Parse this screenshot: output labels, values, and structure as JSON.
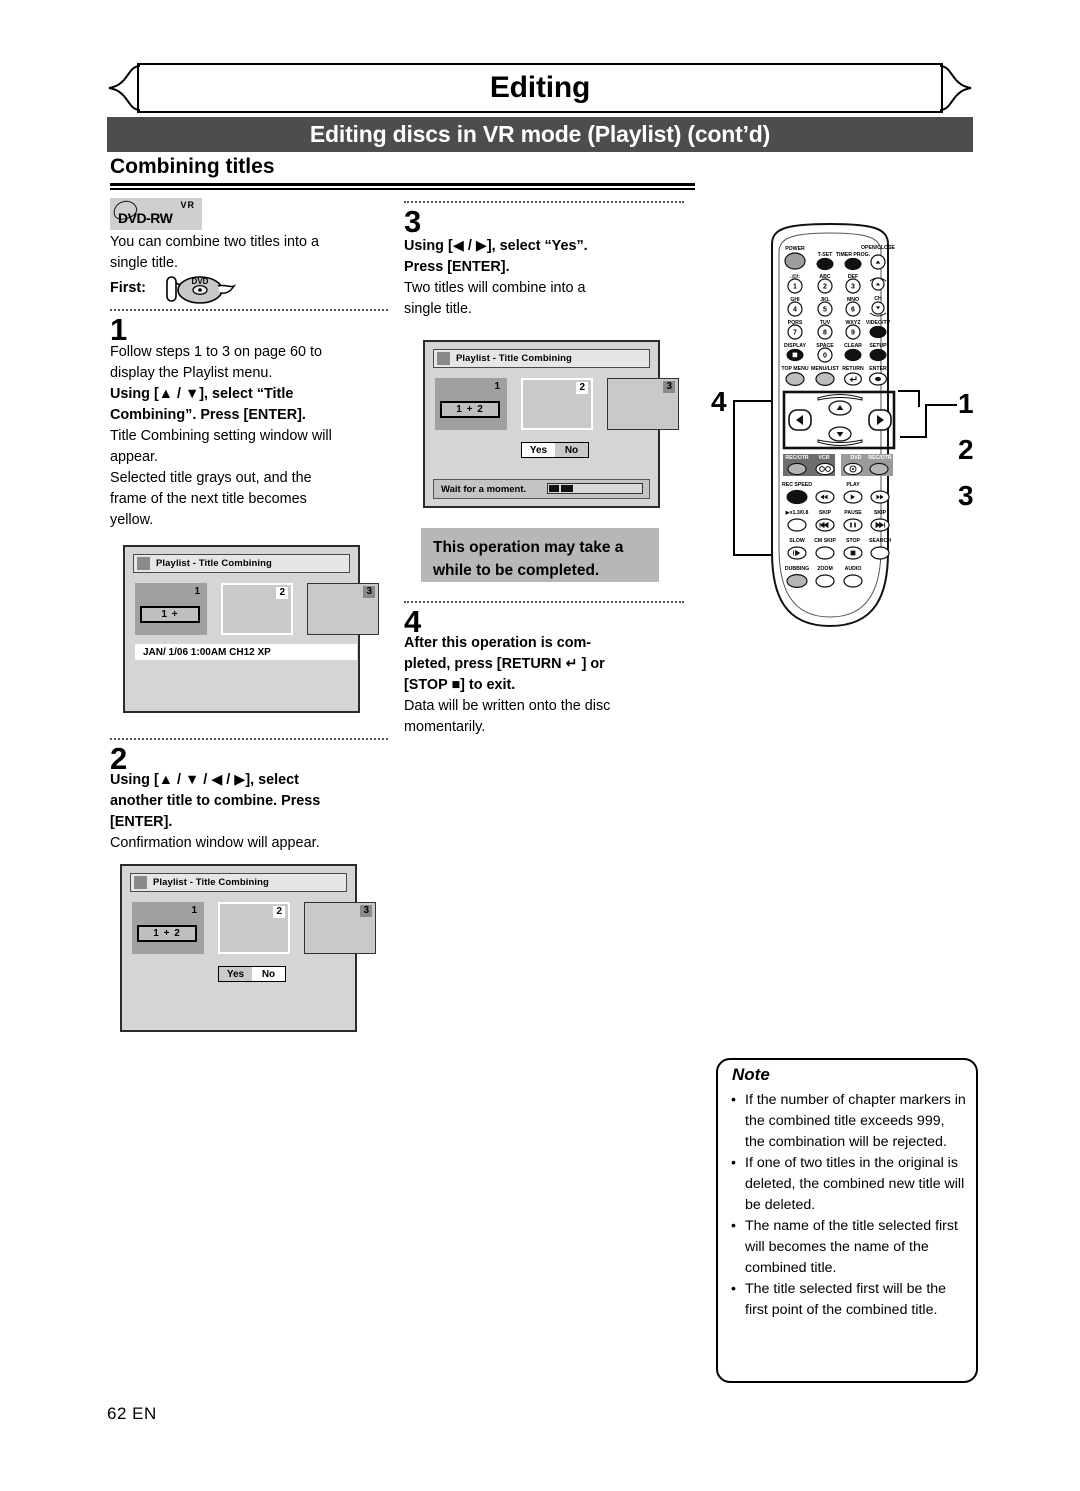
{
  "header": {
    "chapter_title": "Editing",
    "section_bar": "Editing discs in VR mode (Playlist) (cont’d)",
    "subsection": "Combining titles"
  },
  "media_badge": {
    "vr": "VR",
    "disc": "DVD-RW"
  },
  "intro": {
    "line1": "You can combine two titles into a",
    "line2": "single title.",
    "first_label": "First:",
    "first_icon": "dvd-disc-icon"
  },
  "steps": [
    {
      "number": "1",
      "lines": [
        {
          "text": "Follow steps 1 to 3 on page 60 to",
          "bold": false
        },
        {
          "text": "display the Playlist menu.",
          "bold": false
        },
        {
          "text": "Using [▲ / ▼], select “Title",
          "bold": true
        },
        {
          "text": "Combining”. Press [ENTER].",
          "bold": true
        },
        {
          "text": "Title Combining setting window will",
          "bold": false
        },
        {
          "text": "appear.",
          "bold": false
        },
        {
          "text": "Selected title grays out, and the",
          "bold": false
        },
        {
          "text": "frame of the next title becomes",
          "bold": false
        },
        {
          "text": "yellow.",
          "bold": false
        }
      ]
    },
    {
      "number": "2",
      "lines": [
        {
          "text": "Using [▲ / ▼ / ◀ / ▶], select",
          "bold": true
        },
        {
          "text": "another title to combine. Press",
          "bold": true
        },
        {
          "text": "[ENTER].",
          "bold": true
        },
        {
          "text": "Confirmation window will appear.",
          "bold": false
        }
      ]
    },
    {
      "number": "3",
      "lines": [
        {
          "text": "Using [◀ / ▶], select “Yes”.",
          "bold": true
        },
        {
          "text": "Press [ENTER].",
          "bold": true
        },
        {
          "text": "Two titles will combine into a",
          "bold": false
        },
        {
          "text": "single title.",
          "bold": false
        }
      ]
    },
    {
      "number": "4",
      "lines": [
        {
          "text": "After this operation is com-",
          "bold": true
        },
        {
          "text": "pleted, press [RETURN ↵ ] or",
          "bold": true
        },
        {
          "text": "[STOP ■] to exit.",
          "bold": true
        },
        {
          "text": "Data will be written onto the disc",
          "bold": false
        },
        {
          "text": "momentarily.",
          "bold": false
        }
      ]
    }
  ],
  "warning_box": {
    "line1": "This operation may take a",
    "line2": "while to be completed."
  },
  "screens": {
    "step1": {
      "title": "Playlist - Title Combining",
      "thumb1_num": "1",
      "thumb1_label": "1 +",
      "thumb2_num": "2",
      "thumb3_num": "3",
      "info": "JAN/ 1/06 1:00AM CH12 XP"
    },
    "step2": {
      "title": "Playlist - Title Combining",
      "thumb1_num": "1",
      "thumb1_label": "1 + 2",
      "thumb2_num": "2",
      "thumb3_num": "3",
      "yes": "Yes",
      "no": "No"
    },
    "step3": {
      "title": "Playlist - Title Combining",
      "thumb1_num": "1",
      "thumb1_label": "1 + 2",
      "thumb2_num": "2",
      "thumb3_num": "3",
      "yes": "Yes",
      "no": "No",
      "wait": "Wait for a moment."
    }
  },
  "remote": {
    "labels": {
      "power": "POWER",
      "tset": "T-SET",
      "timer_prog": "TIMER PROG.",
      "open_close": "OPEN/CLOSE",
      "k1_top": ".@/:",
      "k1": "1",
      "k2_top": "ABC",
      "k2": "2",
      "k3_top": "DEF",
      "k3": "3",
      "ch": "CH",
      "k4_top": "GHI",
      "k4": "4",
      "k5_top": "JKL",
      "k5": "5",
      "k6_top": "MNO",
      "k6": "6",
      "k7_top": "PQRS",
      "k7": "7",
      "k8_top": "TUV",
      "k8": "8",
      "k9_top": "WXYZ",
      "k9": "9",
      "video_tv": "VIDEO/TV",
      "display": "DISPLAY",
      "space": "SPACE",
      "k0": "0",
      "clear": "CLEAR",
      "setup": "SETUP",
      "top_menu": "TOP MENU",
      "menu_list": "MENU/LIST",
      "return": "RETURN",
      "enter": "ENTER",
      "rec_otr_l": "REC/OTR",
      "vcr": "VCR",
      "dvd": "DVD",
      "rec_otr_r": "REC/OTR",
      "rec_speed": "REC SPEED",
      "play": "PLAY",
      "speed": "▶x1.3/0.8",
      "skip_l": "SKIP",
      "pause": "PAUSE",
      "skip_r": "SKIP",
      "slow": "SLOW",
      "cm_skip": "CM SKIP",
      "stop": "STOP",
      "search": "SEARCH",
      "dubbing": "DUBBING",
      "zoom": "ZOOM",
      "audio": "AUDIO"
    },
    "callouts": {
      "left": "4",
      "right": [
        "1",
        "2",
        "3"
      ]
    }
  },
  "note": {
    "heading": "Note",
    "items": [
      "If the number of chapter markers in the combined title exceeds 999, the combination will be rejected.",
      "If one of two titles in the original is deleted, the combined new title will be deleted.",
      "The name of the title selected first will becomes the name of the combined title.",
      "The title selected first will be the first point of the combined title."
    ]
  },
  "footer": {
    "page": "62   EN"
  }
}
